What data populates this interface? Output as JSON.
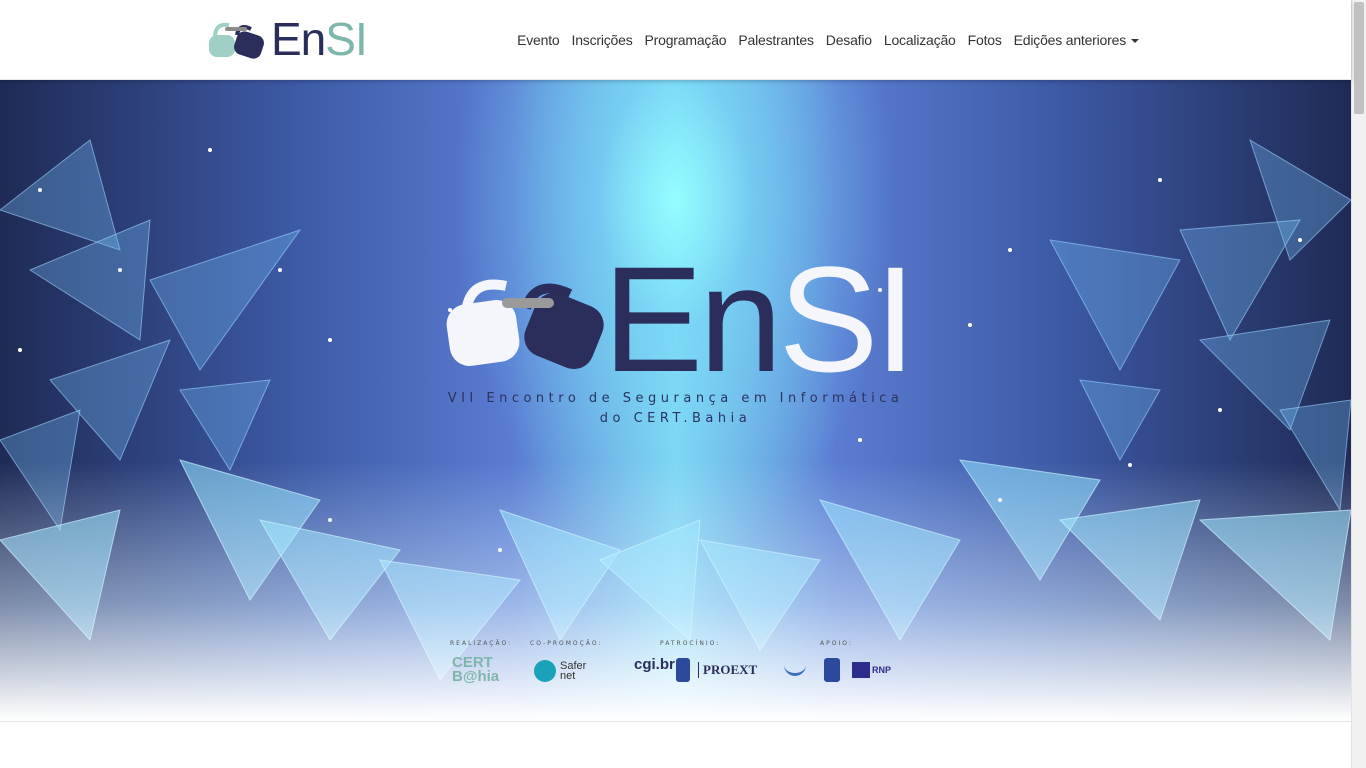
{
  "brand": {
    "en": "En",
    "si": "SI"
  },
  "nav": [
    {
      "label": "Evento"
    },
    {
      "label": "Inscrições"
    },
    {
      "label": "Programação"
    },
    {
      "label": "Palestrantes"
    },
    {
      "label": "Desafio"
    },
    {
      "label": "Localização"
    },
    {
      "label": "Fotos"
    },
    {
      "label": "Edições anteriores"
    }
  ],
  "hero": {
    "title_en": "En",
    "title_si": "SI",
    "subtitle_line1": "VII Encontro de Segurança em Informática",
    "subtitle_line2": "do CERT.Bahia"
  },
  "sponsors": {
    "realizacao": "REALIZAÇÃO:",
    "copromocao": "CO-PROMOÇÃO:",
    "patrocinio": "PATROCÍNIO:",
    "apoio": "APOIO:",
    "cert_top": "CERT",
    "cert_bottom": "B@hia",
    "safer_top": "Safer",
    "safer_bottom": "net",
    "cgi": "cgi.br",
    "proext": "PROEXT",
    "rnp": "RNP"
  },
  "colors": {
    "brand_dark": "#2b2d5a",
    "brand_teal": "#7fb6ac"
  }
}
